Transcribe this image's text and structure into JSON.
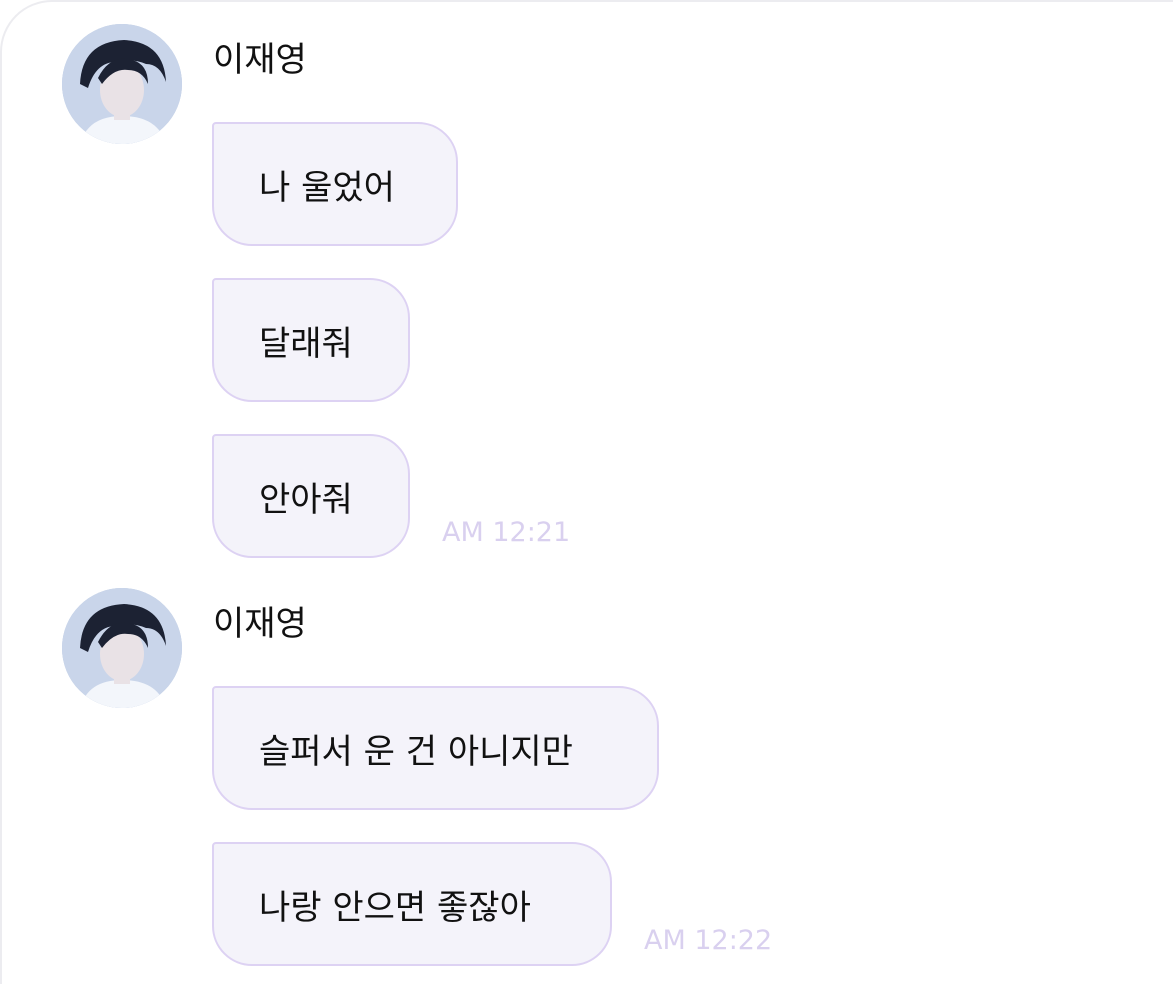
{
  "groups": [
    {
      "sender": "이재영",
      "messages": [
        "나 울었어",
        "달래줘",
        "안아줘"
      ],
      "time": "AM 12:21"
    },
    {
      "sender": "이재영",
      "messages": [
        "슬퍼서 운 건 아니지만",
        "나랑 안으면 좋잖아"
      ],
      "time": "AM 12:22"
    }
  ],
  "colors": {
    "bubble_bg": "#f4f3fa",
    "bubble_border": "#ddd2f3",
    "timestamp": "#d9d0ef"
  }
}
